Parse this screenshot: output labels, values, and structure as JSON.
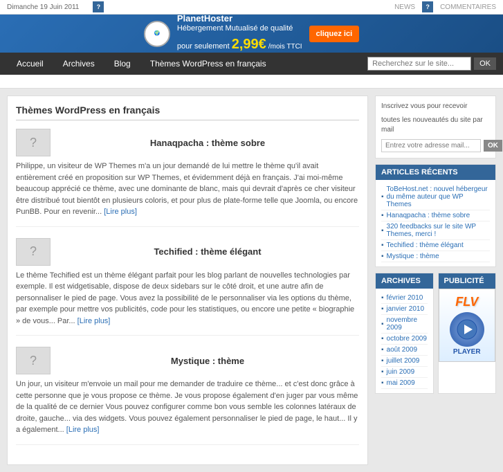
{
  "topbar": {
    "date": "Dimanche 19 Juin 2011",
    "news_label": "NEWS",
    "commentaires_label": "COMMENTAIRES"
  },
  "ad": {
    "logo_text": "PlanetHoster",
    "headline": "Hébergement Mutualisé de qualité",
    "price": "2,99€",
    "price_suffix": "/mois TTCI",
    "cta": "cliquez ici"
  },
  "nav": {
    "items": [
      {
        "label": "Accueil",
        "active": false
      },
      {
        "label": "Archives",
        "active": false
      },
      {
        "label": "Blog",
        "active": false
      },
      {
        "label": "Thèmes WordPress en français",
        "active": false
      }
    ],
    "search_placeholder": "Recherchez sur le site...",
    "search_button": "OK"
  },
  "subnav": {
    "text": ""
  },
  "content": {
    "page_title": "Thèmes WordPress en français",
    "articles": [
      {
        "title": "Hanaqpacha : thème sobre",
        "body": "Philippe, un visiteur de WP Themes m'a un jour demandé de lui mettre le thème qu'il avait entièrement créé en proposition sur WP Themes, et évidemment déjà en français. J'ai moi-même beaucoup apprécié ce thème, avec une dominante de blanc, mais qui devrait d'après ce cher visiteur être distribué tout bientôt en plusieurs coloris, et pour plus de plate-forme telle que Joomla, ou encore PunBB. Pour en revenir...",
        "read_more": "[Lire plus]"
      },
      {
        "title": "Techified : thème élégant",
        "body": "Le thème Techified est un thème élégant parfait pour les blog parlant de nouvelles technologies par exemple. Il est widgetisable, dispose de deux sidebars sur le côté droit, et une autre afin de personnaliser le pied de page. Vous avez la possibilité de le personnaliser via les options du thème, par exemple pour mettre vos publicités, code pour les statistiques, ou encore une petite « biographie » de vous... Par...",
        "read_more": "[Lire plus]"
      },
      {
        "title": "Mystique : thème",
        "body": "Un jour, un visiteur m'envoie un mail pour me demander de traduire ce thème... et c'est donc grâce à cette personne que je vous propose ce thème. Je vous propose également d'en juger par vous même de la qualité de ce dernier Vous pouvez configurer comme bon vous semble les colonnes latéraux de droite, gauche... via des widgets. Vous pouvez également personnaliser le pied de page, le haut... Il y a également...",
        "read_more": "[Lire plus]"
      }
    ]
  },
  "sidebar": {
    "newsletter": {
      "text1": "Inscrivez vous pour recevoir",
      "text2": "toutes les nouveautés du site par mail",
      "input_placeholder": "Entrez votre adresse mail...",
      "button": "OK"
    },
    "recent_articles": {
      "title": "ARTICLES RÉCENTS",
      "items": [
        "ToBeHost.net : nouvel hébergeur du même auteur que WP Themes",
        "Hanaqpacha : thème sobre",
        "320 feedbacks sur le site WP Themes, merci !",
        "Techified : thème élégant",
        "Mystique : thème"
      ]
    },
    "archives": {
      "title": "ARCHIVES",
      "items": [
        "février 2010",
        "janvier 2010",
        "novembre 2009",
        "octobre 2009",
        "août 2009",
        "juillet 2009",
        "juin 2009",
        "mai 2009"
      ]
    },
    "publicite": {
      "title": "PUBLICITÉ",
      "flv_text": "FLV",
      "player_text": "PLAYER"
    }
  }
}
